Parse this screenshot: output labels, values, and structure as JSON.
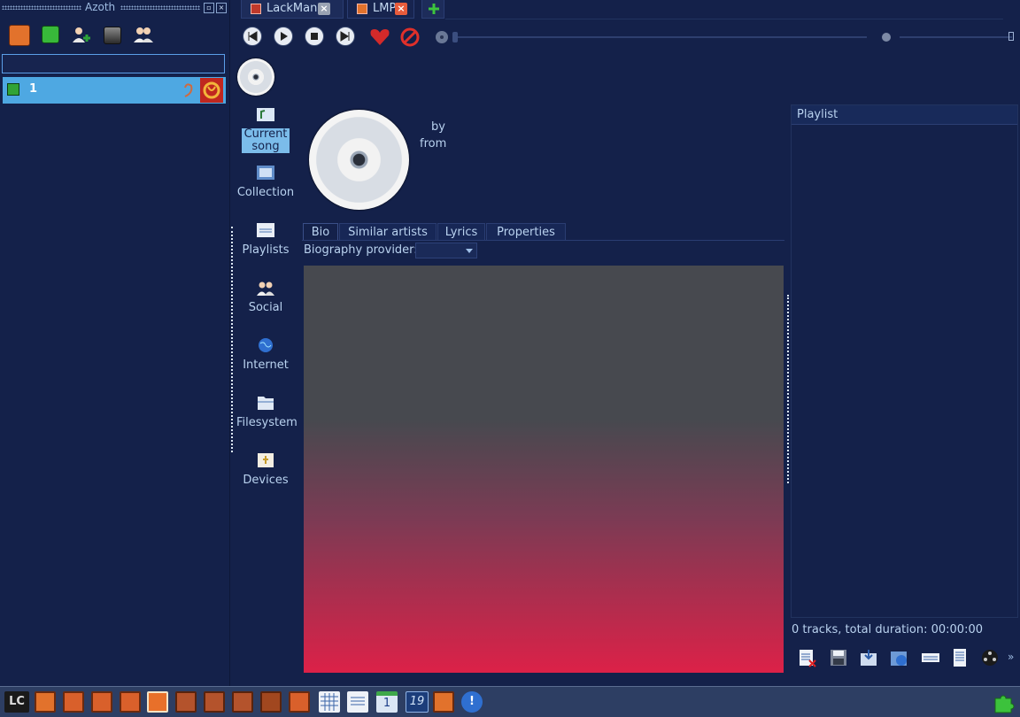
{
  "azoth": {
    "title": "Azoth",
    "search": {
      "value": "",
      "placeholder": ""
    },
    "account": {
      "name": "1"
    }
  },
  "tabs": [
    {
      "label": "LackMan"
    },
    {
      "label": "LMP"
    }
  ],
  "nav": {
    "items": [
      {
        "label": "Current song",
        "selected": true
      },
      {
        "label": "Collection"
      },
      {
        "label": "Playlists"
      },
      {
        "label": "Social"
      },
      {
        "label": "Internet"
      },
      {
        "label": "Filesystem"
      },
      {
        "label": "Devices"
      }
    ]
  },
  "now_playing": {
    "by_label": "by",
    "from_label": "from"
  },
  "info_tabs": [
    "Bio",
    "Similar artists",
    "Lyrics",
    "Properties"
  ],
  "bio": {
    "provider_label": "Biography provider:",
    "provider_value": ""
  },
  "playlist": {
    "title": "Playlist",
    "status": "0 tracks, total duration: 00:00:00"
  },
  "taskbar": {
    "launcher": "LC",
    "calendar_day_1": "1",
    "calendar_day_2": "19"
  },
  "colors": {
    "accent": "#4ea8e2",
    "background": "#14214a",
    "text": "#b9d2ef",
    "gradient_bottom": "#dc2148"
  }
}
